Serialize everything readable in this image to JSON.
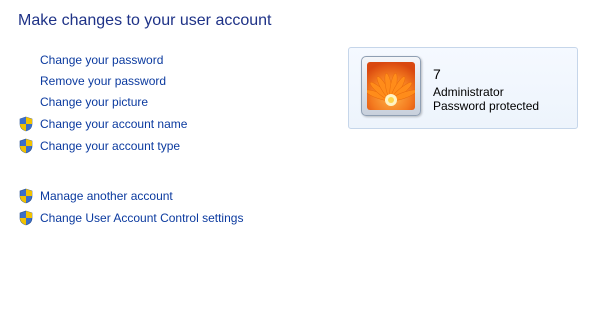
{
  "page": {
    "title": "Make changes to your user account"
  },
  "tasks": [
    {
      "label": "Change your password",
      "shield": false
    },
    {
      "label": "Remove your password",
      "shield": false
    },
    {
      "label": "Change your picture",
      "shield": false
    },
    {
      "label": "Change your account name",
      "shield": true
    },
    {
      "label": "Change your account type",
      "shield": true
    },
    {
      "label": "Manage another account",
      "shield": true
    },
    {
      "label": "Change User Account Control settings",
      "shield": true
    }
  ],
  "account": {
    "name": "7",
    "role": "Administrator",
    "status": "Password protected",
    "picture_icon": "orange-flower-icon"
  },
  "colors": {
    "title": "#1e3287",
    "link": "#0b3a9f",
    "card_border": "#c6d6ea"
  }
}
